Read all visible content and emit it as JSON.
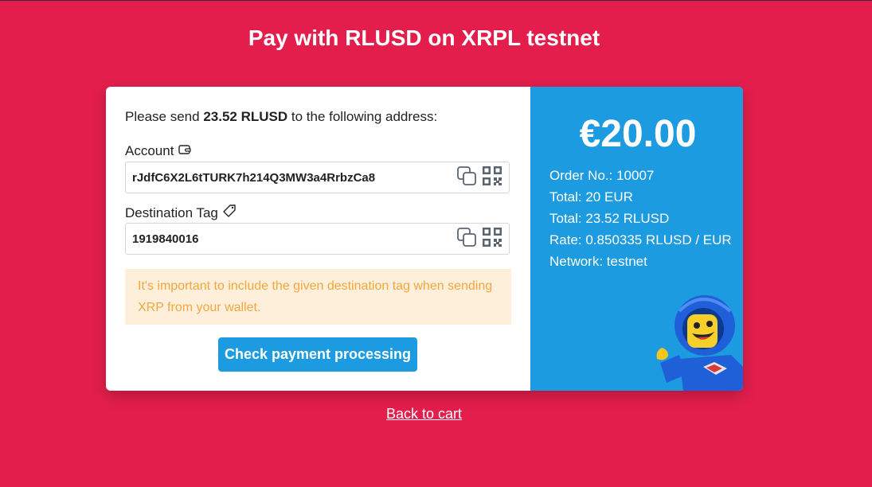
{
  "page": {
    "title": "Pay with RLUSD on XRPL testnet",
    "back_link": "Back to cart"
  },
  "colors": {
    "background": "#e31e4c",
    "accent": "#1c9be0",
    "warning_bg": "#fdefd9",
    "warning_text": "#f3a73e"
  },
  "payment": {
    "instruction_prefix": "Please send",
    "instruction_amount": "23.52 RLUSD",
    "instruction_suffix": "to the following address:",
    "account_label": "Account",
    "account_icon": "wallet-icon",
    "account_value": "rJdfC6X2L6tTURK7h214Q3MW3a4RrbzCa8",
    "tag_label": "Destination Tag",
    "tag_icon": "tag-icon",
    "tag_value": "1919840016",
    "warning": "It's important to include the given destination tag when sending XRP from your wallet.",
    "check_button": "Check payment processing"
  },
  "summary": {
    "amount": "€20.00",
    "lines": [
      "Order No.: 10007",
      "Total: 20 EUR",
      "Total: 23.52 RLUSD",
      "Rate: 0.850335 RLUSD / EUR",
      "Network: testnet"
    ]
  }
}
